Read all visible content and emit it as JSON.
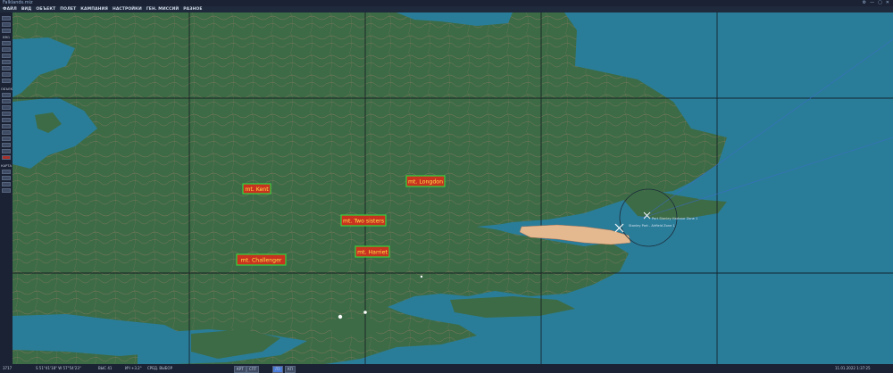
{
  "window": {
    "title": "Falklands.miz",
    "controls": [
      "⚙",
      "—",
      "▢",
      "✕"
    ]
  },
  "menu": {
    "items": [
      "ФАЙЛ",
      "ВИД",
      "ОБЪЕКТ",
      "ПОЛЕТ",
      "КАМПАНИЯ",
      "НАСТРОЙКИ",
      "ГЕН. МИССИЙ",
      "РАЗНОЕ"
    ]
  },
  "toolbar": {
    "labels": [
      "BRG",
      "ОБЪЕКТ",
      "КАРТА"
    ]
  },
  "map": {
    "colors": {
      "sea": "#2a7d99",
      "land": "#3d6b46",
      "contour": "#c98472",
      "grid": "#10161c",
      "label_bg": "#c8321f",
      "label_border": "#34d03c",
      "label_text": "#ffe04a",
      "town": "#e5b98f"
    },
    "mountain_labels": [
      {
        "id": "kent",
        "text": "mt. Kent"
      },
      {
        "id": "longdon",
        "text": "mt. Longdon"
      },
      {
        "id": "two-sisters",
        "text": "mt. Two sisters"
      },
      {
        "id": "harriet",
        "text": "mt. Harriet"
      },
      {
        "id": "challenger",
        "text": "mt. Challenger"
      }
    ],
    "markers": [
      {
        "id": "airfield-unit",
        "text": "Stanley Port - Airfield Zone 1",
        "icon": "cross-marker-icon"
      },
      {
        "id": "harbour-unit",
        "text": "Port Stanley Harbour Zone 1",
        "icon": "cross-marker-icon"
      }
    ]
  },
  "status": {
    "altitude_label": "3717",
    "coords": "S 51°41'18\"  W 57°54'23\"",
    "heading": "ВЫС 41",
    "alt_value": "ИЧ +3.2°",
    "mode": "СРЕД. ВЫБОР",
    "buttons": [
      "КРТ",
      "СПТ",
      "ЛЗ",
      "КП"
    ],
    "datetime": "11.01.2022 1:37:25"
  }
}
